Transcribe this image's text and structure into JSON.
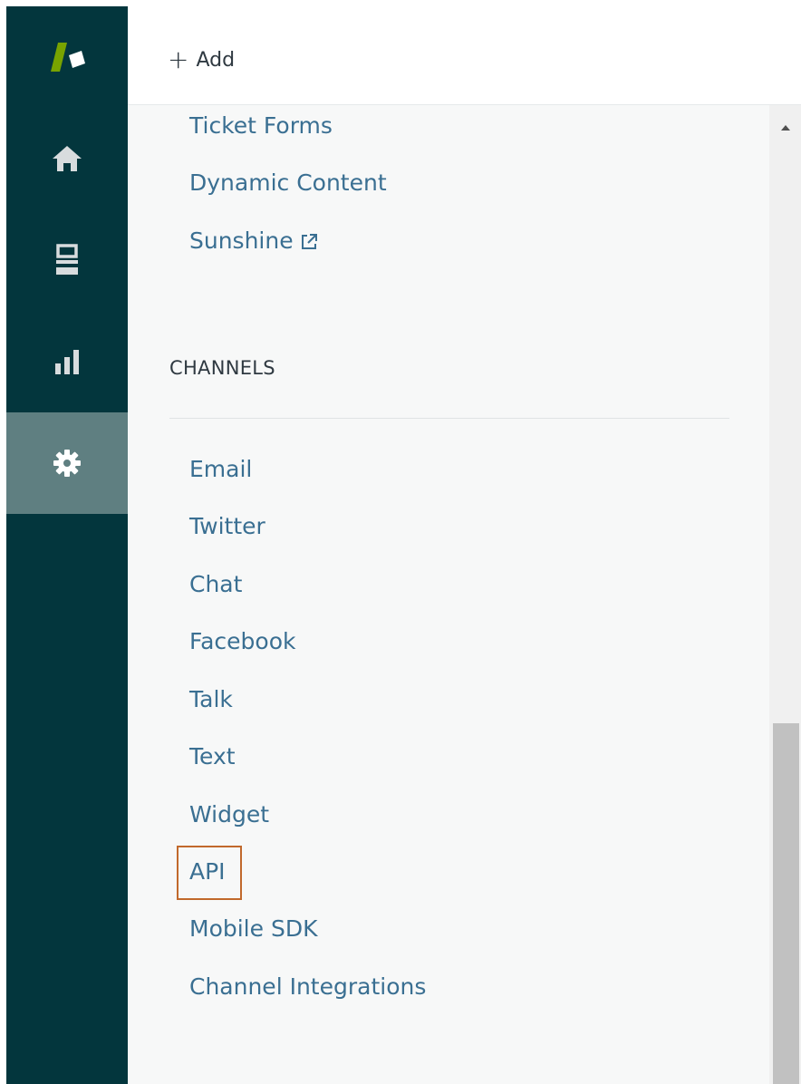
{
  "topbar": {
    "add_label": "Add"
  },
  "rail": {
    "items": [
      {
        "icon": "home-icon"
      },
      {
        "icon": "views-icon"
      },
      {
        "icon": "reporting-icon"
      },
      {
        "icon": "gear-icon"
      }
    ],
    "active_index": 3
  },
  "menu": {
    "upper_links": [
      "Ticket Forms",
      "Dynamic Content",
      "Sunshine"
    ],
    "channels_heading": "CHANNELS",
    "channel_links": [
      "Email",
      "Twitter",
      "Chat",
      "Facebook",
      "Talk",
      "Text",
      "Widget",
      "API",
      "Mobile SDK",
      "Channel Integrations"
    ],
    "highlighted": "API"
  },
  "colors": {
    "rail": "#03363d",
    "rail_active": "#5f7f81",
    "link": "#3a6f92",
    "logo_green": "#78a300",
    "highlight": "#c1692c"
  }
}
